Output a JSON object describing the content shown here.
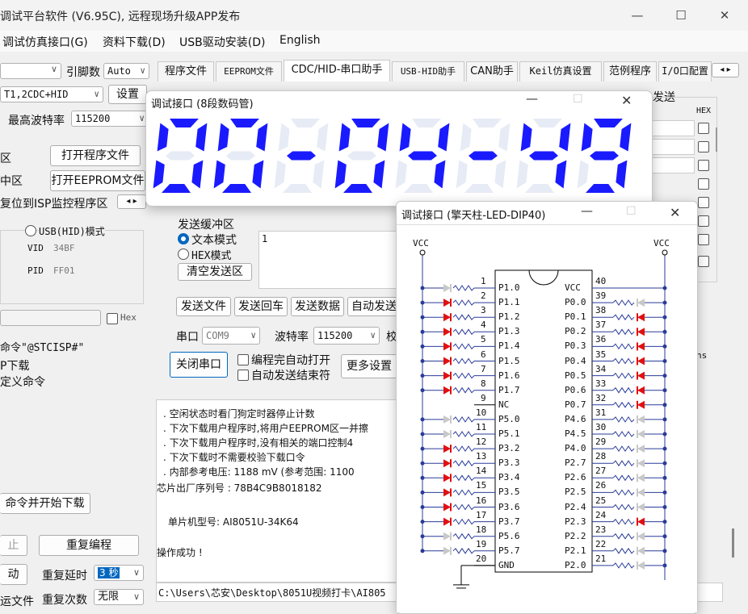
{
  "titlebar": {
    "title": "调试平台软件 (V6.95C), 远程现场升级APP发布",
    "min": "—",
    "max": "☐",
    "close": "✕"
  },
  "menu": [
    "调试仿真接口(G)",
    "资料下载(D)",
    "USB驱动安装(D)",
    "English"
  ],
  "left": {
    "pin_label": "引脚数",
    "pin_value": "Auto",
    "combo1_value": "T1,2CDC+HID",
    "settings_btn": "设置",
    "baud_label": "最高波特率",
    "baud_value": "115200",
    "row1_label": "区",
    "open_prog_btn": "打开程序文件",
    "row2_label": "中区",
    "open_eeprom_btn": "打开EEPROM文件",
    "reset_text": "复位到ISP监控程序区",
    "usb_mode": "USB(HID)模式",
    "vid_label": "VID",
    "vid_value": "34BF",
    "pid_label": "PID",
    "pid_value": "FF01",
    "hex_label": "Hex",
    "cmd1": "命令\"@STCISP#\"",
    "cmd2": "P下载",
    "cmd3": "定义命令",
    "start_btn": "命令并开始下载",
    "stop_label": "止",
    "reprogram_btn": "重复编程",
    "move_label": "动",
    "repeat_delay_label": "重复延时",
    "repeat_delay_value": "3 秒",
    "file_label": "运文件",
    "repeat_count_label": "重复次数",
    "repeat_count_value": "无限"
  },
  "tabs": [
    "程序文件",
    "EEPROM文件",
    "CDC/HID-串口助手",
    "USB-HID助手",
    "CAN助手",
    "Keil仿真设置",
    "范例程序",
    "I/O口配置"
  ],
  "serial": {
    "send_label": "发送缓冲区",
    "text_mode": "文本模式",
    "hex_mode": "HEX模式",
    "send_content": "1",
    "clear_btn": "清空发送区",
    "send_file": "发送文件",
    "send_cr": "发送回车",
    "send_data": "发送数据",
    "auto_send": "自动发送",
    "port_label": "串口",
    "port_value": "COM9",
    "baud_label": "波特率",
    "baud_value": "115200",
    "check_label": "校",
    "close_port": "关闭串口",
    "auto_open": "编程完自动打开",
    "auto_send_end": "自动发送结束符",
    "more_settings": "更多设置",
    "right_send": "发送",
    "hex_header": "HEX",
    "ms_label": "ns"
  },
  "log": [
    ". 空闲状态时看门狗定时器停止计数",
    ". 下次下载用户程序时,将用户EEPROM区一并擦",
    ". 下次下载用户程序时,没有相关的端口控制4",
    ". 下次下载时不需要校验下载口令",
    ". 内部参考电压: 1188 mV (参考范围: 1100",
    "芯片出厂序列号 : 78B4C9B8018182",
    "",
    "  单片机型号: AI8051U-34K64",
    "",
    "操作成功 !"
  ],
  "path": "C:\\Users\\芯安\\Desktop\\8051U视频打卡\\AI805",
  "seg_window": {
    "title": "调试接口 (8段数码管)",
    "display": "00-04-49",
    "color": "#1a1aff"
  },
  "led_window": {
    "title": "调试接口 (擎天柱-LED-DIP40)",
    "vcc": "VCC",
    "gnd_symbol": "GND",
    "left_pins": [
      {
        "num": "1",
        "name": "P1.0",
        "led": "off"
      },
      {
        "num": "2",
        "name": "P1.1",
        "led": "on"
      },
      {
        "num": "3",
        "name": "P1.2",
        "led": "on"
      },
      {
        "num": "4",
        "name": "P1.3",
        "led": "on"
      },
      {
        "num": "5",
        "name": "P1.4",
        "led": "on"
      },
      {
        "num": "6",
        "name": "P1.5",
        "led": "on"
      },
      {
        "num": "7",
        "name": "P1.6",
        "led": "on"
      },
      {
        "num": "8",
        "name": "P1.7",
        "led": "on"
      },
      {
        "num": "9",
        "name": "NC",
        "led": "none"
      },
      {
        "num": "10",
        "name": "P5.0",
        "led": "off"
      },
      {
        "num": "11",
        "name": "P5.1",
        "led": "off"
      },
      {
        "num": "12",
        "name": "P3.2",
        "led": "on"
      },
      {
        "num": "13",
        "name": "P3.3",
        "led": "on"
      },
      {
        "num": "14",
        "name": "P3.4",
        "led": "on"
      },
      {
        "num": "15",
        "name": "P3.5",
        "led": "on"
      },
      {
        "num": "16",
        "name": "P3.6",
        "led": "on"
      },
      {
        "num": "17",
        "name": "P3.7",
        "led": "on"
      },
      {
        "num": "18",
        "name": "P5.6",
        "led": "off"
      },
      {
        "num": "19",
        "name": "P5.7",
        "led": "off"
      },
      {
        "num": "20",
        "name": "GND",
        "led": "none"
      }
    ],
    "right_pins": [
      {
        "num": "40",
        "name": "VCC",
        "led": "none"
      },
      {
        "num": "39",
        "name": "P0.0",
        "led": "off"
      },
      {
        "num": "38",
        "name": "P0.1",
        "led": "on"
      },
      {
        "num": "37",
        "name": "P0.2",
        "led": "on"
      },
      {
        "num": "36",
        "name": "P0.3",
        "led": "on"
      },
      {
        "num": "35",
        "name": "P0.4",
        "led": "on"
      },
      {
        "num": "34",
        "name": "P0.5",
        "led": "on"
      },
      {
        "num": "33",
        "name": "P0.6",
        "led": "on"
      },
      {
        "num": "32",
        "name": "P0.7",
        "led": "on"
      },
      {
        "num": "31",
        "name": "P4.6",
        "led": "off"
      },
      {
        "num": "30",
        "name": "P4.5",
        "led": "off"
      },
      {
        "num": "29",
        "name": "P4.0",
        "led": "off"
      },
      {
        "num": "28",
        "name": "P2.7",
        "led": "off"
      },
      {
        "num": "27",
        "name": "P2.6",
        "led": "off"
      },
      {
        "num": "26",
        "name": "P2.5",
        "led": "off"
      },
      {
        "num": "25",
        "name": "P2.4",
        "led": "off"
      },
      {
        "num": "24",
        "name": "P2.3",
        "led": "on"
      },
      {
        "num": "23",
        "name": "P2.2",
        "led": "off"
      },
      {
        "num": "22",
        "name": "P2.1",
        "led": "off"
      },
      {
        "num": "21",
        "name": "P2.0",
        "led": "off"
      }
    ],
    "led_on_color": "#e01010",
    "led_off_color": "#c8c8c8"
  }
}
